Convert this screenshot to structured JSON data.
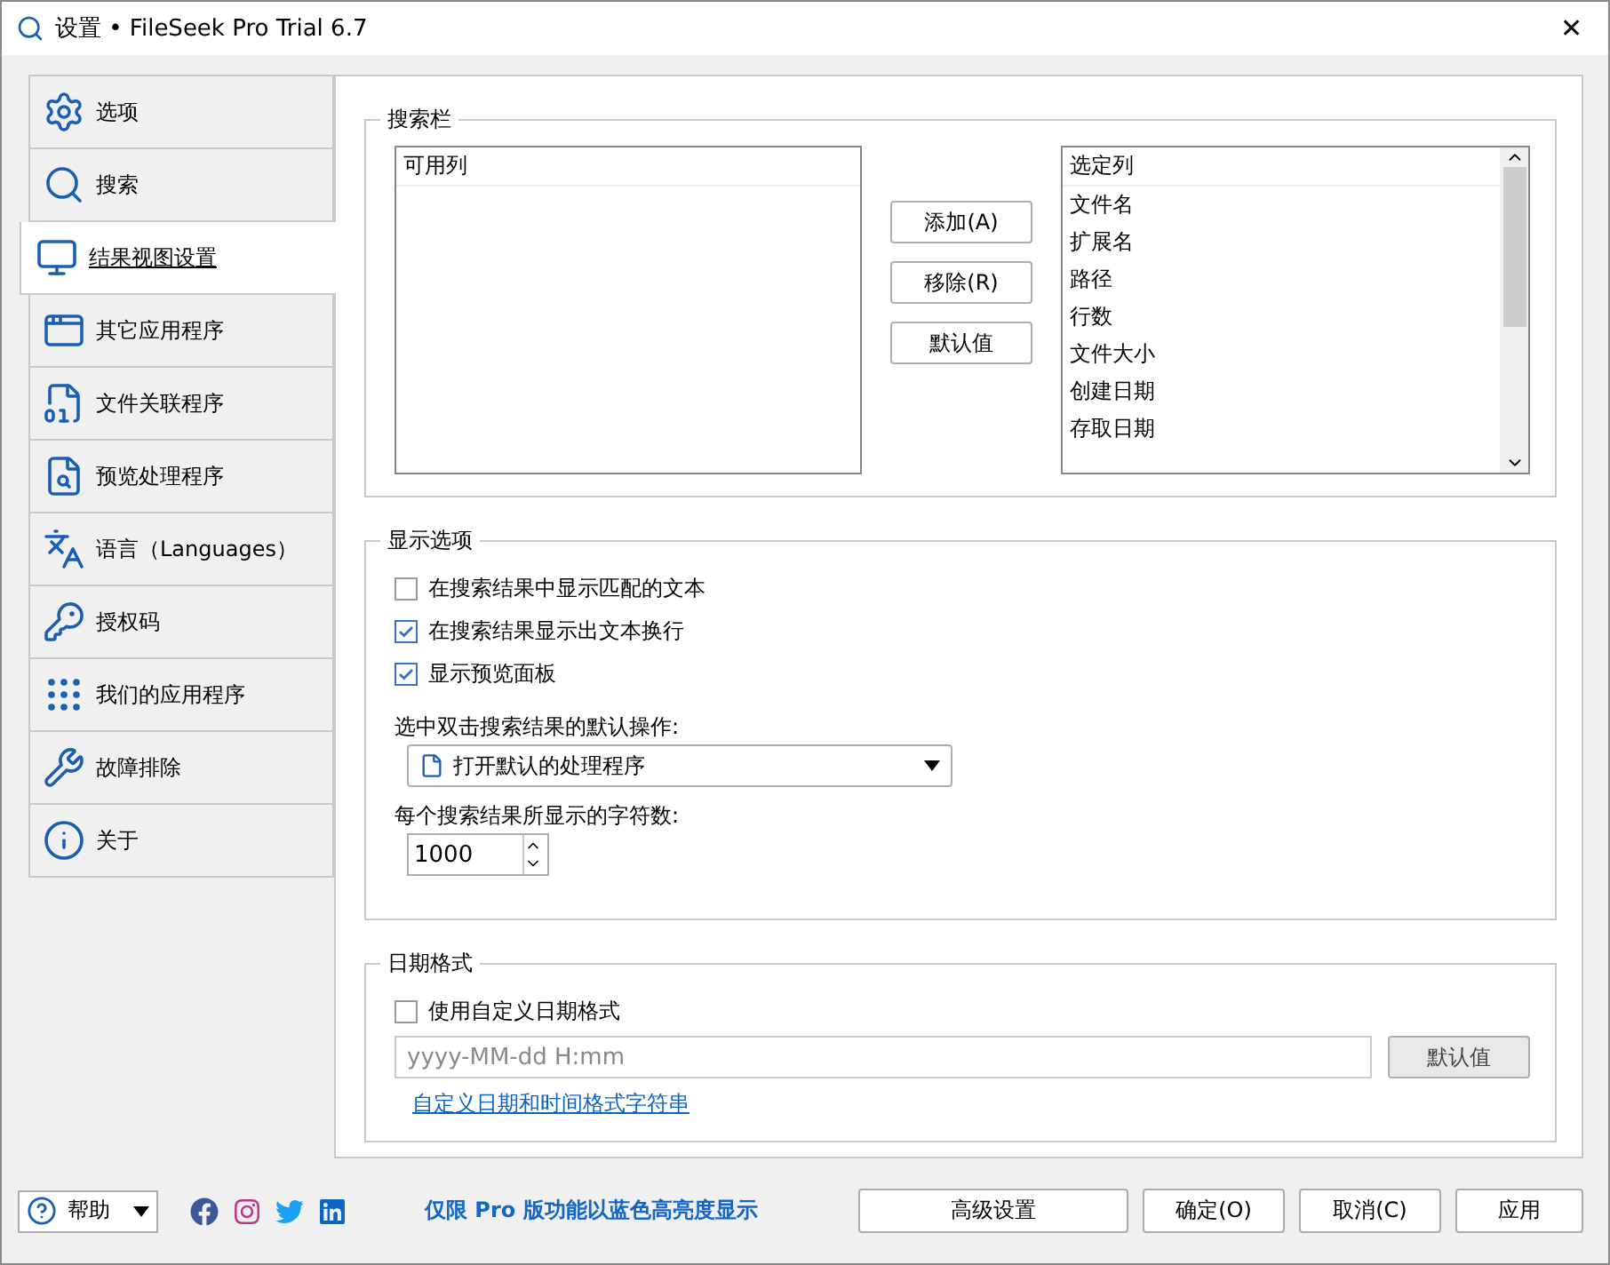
{
  "window": {
    "title": "设置 • FileSeek Pro Trial 6.7",
    "close": "✕"
  },
  "sidebar": {
    "items": [
      {
        "label": "选项",
        "selected": false
      },
      {
        "label": "搜索",
        "selected": false
      },
      {
        "label": "结果视图设置",
        "selected": true
      },
      {
        "label": "其它应用程序",
        "selected": false
      },
      {
        "label": "文件关联程序",
        "selected": false
      },
      {
        "label": "预览处理程序",
        "selected": false
      },
      {
        "label": "语言（Languages）",
        "selected": false
      },
      {
        "label": "授权码",
        "selected": false
      },
      {
        "label": "我们的应用程序",
        "selected": false
      },
      {
        "label": "故障排除",
        "selected": false
      },
      {
        "label": "关于",
        "selected": false
      }
    ]
  },
  "search_bar_group": {
    "title": "搜索栏",
    "available": {
      "header": "可用列"
    },
    "buttons": [
      "添加(A)",
      "移除(R)",
      "默认值"
    ],
    "selected": {
      "header": "选定列",
      "items": [
        "文件名",
        "扩展名",
        "路径",
        "行数",
        "文件大小",
        "创建日期",
        "存取日期"
      ]
    }
  },
  "display_group": {
    "title": "显示选项",
    "checkboxes": [
      {
        "label": "在搜索结果中显示匹配的文本",
        "checked": false
      },
      {
        "label": "在搜索结果显示出文本换行",
        "checked": true
      },
      {
        "label": "显示预览面板",
        "checked": true
      }
    ],
    "action_label": "选中双击搜索结果的默认操作:",
    "action_value": "打开默认的处理程序",
    "chars_label": "每个搜索结果所显示的字符数:",
    "chars_value": "1000"
  },
  "date_group": {
    "title": "日期格式",
    "checkbox": {
      "label": "使用自定义日期格式",
      "checked": false
    },
    "placeholder": "yyyy-MM-dd H:mm",
    "default_button": "默认值",
    "link": "自定义日期和时间格式字符串"
  },
  "footer": {
    "help": "帮助",
    "notice": "仅限 Pro 版功能以蓝色高亮度显示",
    "buttons": [
      "高级设置",
      "确定(O)",
      "取消(C)",
      "应用"
    ]
  }
}
